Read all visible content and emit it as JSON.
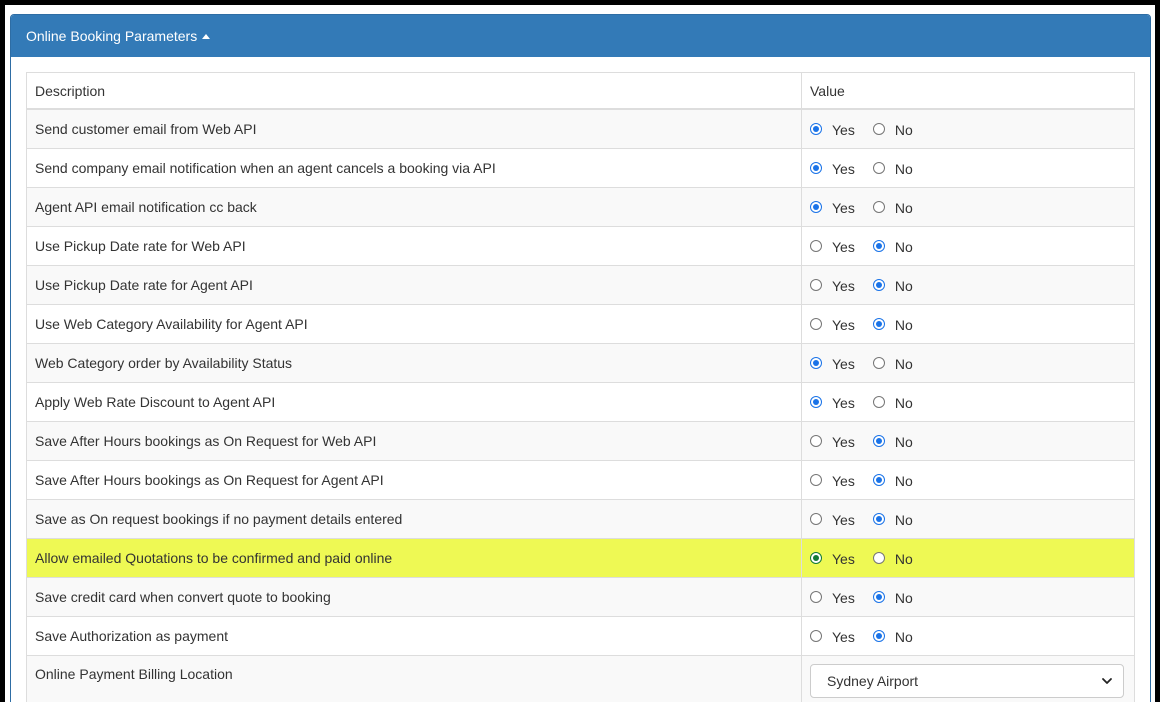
{
  "panel": {
    "title": "Online Booking Parameters",
    "header_color": "#337ab7",
    "highlight_color": "#eef954"
  },
  "table": {
    "headers": {
      "description": "Description",
      "value": "Value"
    },
    "yes_label": "Yes",
    "no_label": "No",
    "rows": [
      {
        "description": "Send customer email from Web API",
        "value": "Yes"
      },
      {
        "description": "Send company email notification when an agent cancels a booking via API",
        "value": "Yes"
      },
      {
        "description": "Agent API email notification cc back",
        "value": "Yes"
      },
      {
        "description": "Use Pickup Date rate for Web API",
        "value": "No"
      },
      {
        "description": "Use Pickup Date rate for Agent API",
        "value": "No"
      },
      {
        "description": "Use Web Category Availability for Agent API",
        "value": "No"
      },
      {
        "description": "Web Category order by Availability Status",
        "value": "Yes"
      },
      {
        "description": "Apply Web Rate Discount to Agent API",
        "value": "Yes"
      },
      {
        "description": "Save After Hours bookings as On Request for Web API",
        "value": "No"
      },
      {
        "description": "Save After Hours bookings as On Request for Agent API",
        "value": "No"
      },
      {
        "description": "Save as On request bookings if no payment details entered",
        "value": "No"
      },
      {
        "description": "Allow emailed Quotations to be confirmed and paid online",
        "value": "Yes",
        "highlighted": true
      },
      {
        "description": "Save credit card when convert quote to booking",
        "value": "No"
      },
      {
        "description": "Save Authorization as payment",
        "value": "No"
      }
    ],
    "billing_location": {
      "description": "Online Payment Billing Location",
      "selected": "Sydney Airport"
    }
  }
}
